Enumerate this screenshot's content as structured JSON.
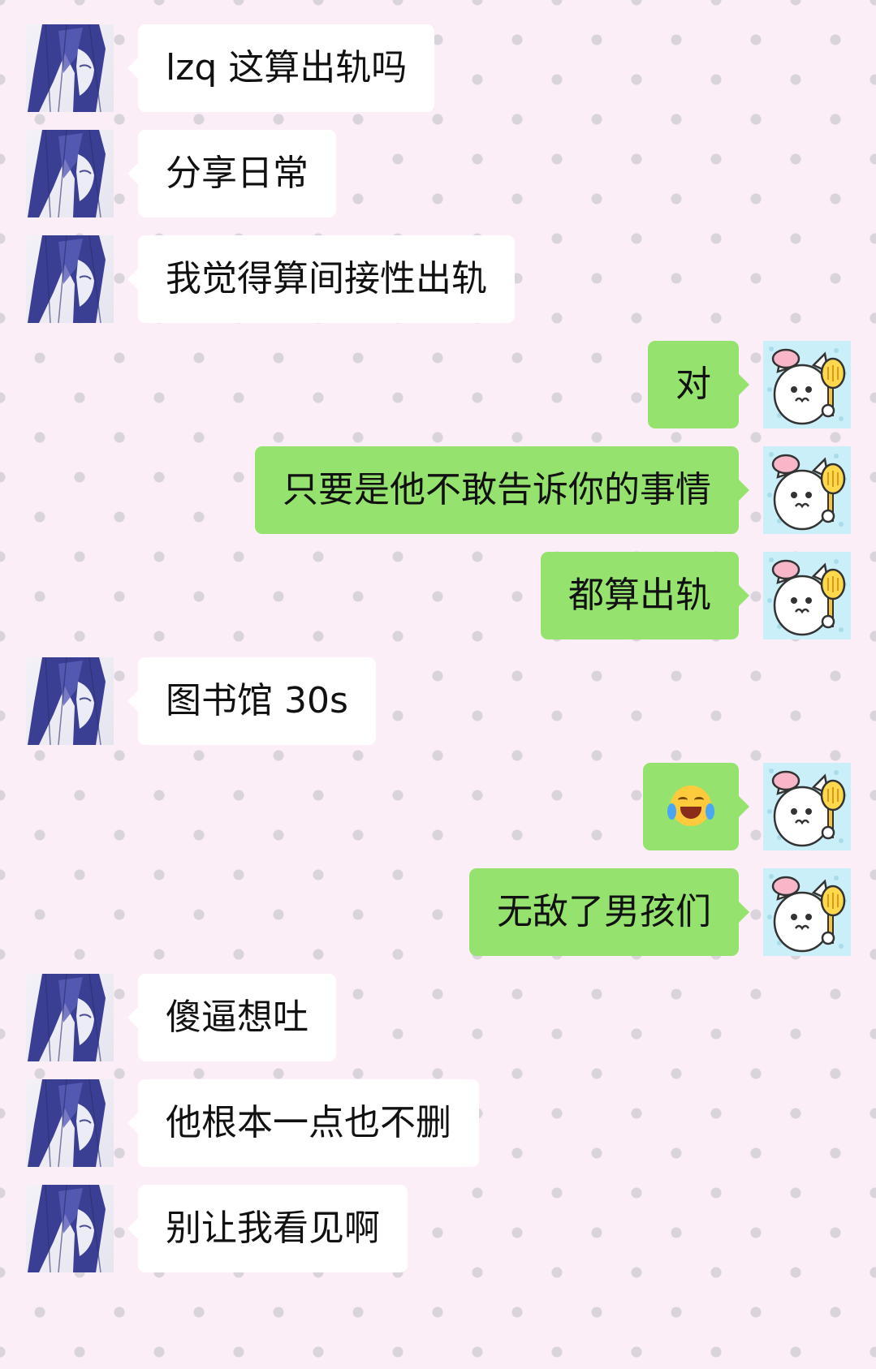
{
  "colors": {
    "sent_bubble": "#95e36e",
    "received_bubble": "#ffffff",
    "background": "#fbeef7",
    "dots": "#d9d3dc"
  },
  "icons": {
    "contact_avatar": "long-haired-anime-girl-avatar",
    "self_avatar": "white-cat-chef-holding-spatula-avatar",
    "emoji": "rolling-on-floor-laughing-emoji"
  },
  "messages": [
    {
      "side": "left",
      "text": "lzq 这算出轨吗"
    },
    {
      "side": "left",
      "text": "分享日常"
    },
    {
      "side": "left",
      "text": "我觉得算间接性出轨"
    },
    {
      "side": "right",
      "text": "对"
    },
    {
      "side": "right",
      "text": "只要是他不敢告诉你的事情"
    },
    {
      "side": "right",
      "text": "都算出轨"
    },
    {
      "side": "left",
      "text": "图书馆 30s"
    },
    {
      "side": "right",
      "text": "",
      "emoji": "rolling-on-floor-laughing-emoji"
    },
    {
      "side": "right",
      "text": "无敌了男孩们"
    },
    {
      "side": "left",
      "text": "傻逼想吐"
    },
    {
      "side": "left",
      "text": "他根本一点也不删"
    },
    {
      "side": "left",
      "text": "别让我看见啊"
    }
  ]
}
